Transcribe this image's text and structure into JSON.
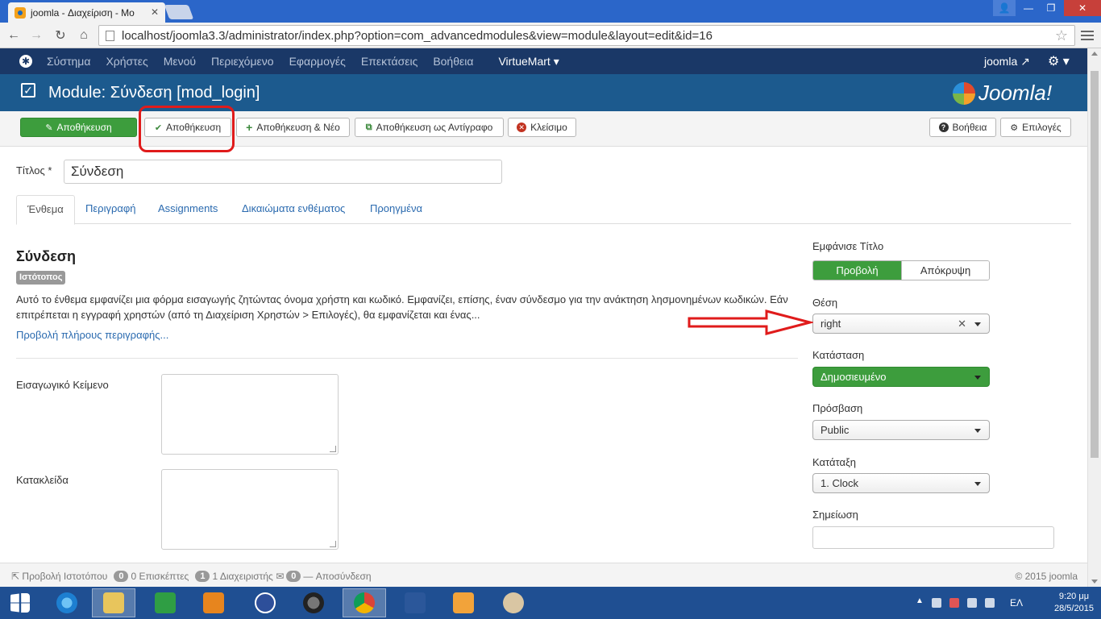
{
  "browser": {
    "tab_title": "joomla - Διαχείριση - Mo",
    "url": "localhost/joomla3.3/administrator/index.php?option=com_advancedmodules&view=module&layout=edit&id=16"
  },
  "nav": {
    "items": [
      "Σύστημα",
      "Χρήστες",
      "Μενού",
      "Περιεχόμενο",
      "Εφαρμογές",
      "Επεκτάσεις",
      "Βοήθεια"
    ],
    "virtuemart": "VirtueMart",
    "user": "joomla"
  },
  "header": {
    "title": "Module: Σύνδεση [mod_login]",
    "brand": "Joomla!"
  },
  "toolbar": {
    "apply": "Αποθήκευση",
    "save": "Αποθήκευση",
    "save_new": "Αποθήκευση & Νέο",
    "save_copy": "Αποθήκευση ως Αντίγραφο",
    "close": "Κλείσιμο",
    "help": "Βοήθεια",
    "options": "Επιλογές"
  },
  "form": {
    "title_label": "Τίτλος *",
    "title_value": "Σύνδεση",
    "tabs": [
      "Ένθεμα",
      "Περιγραφή",
      "Assignments",
      "Δικαιώματα ενθέματος",
      "Προηγμένα"
    ],
    "module_name": "Σύνδεση",
    "badge": "Ιστότοπος",
    "description": "Αυτό το ένθεμα εμφανίζει μια φόρμα εισαγωγής ζητώντας όνομα χρήστη και κωδικό. Εμφανίζει, επίσης, έναν σύνδεσμο για την ανάκτηση λησμονημένων κωδικών. Εάν επιτρέπεται η εγγραφή χρηστών (από τη Διαχείριση Χρηστών > Επιλογές), θα εμφανίζεται και ένας...",
    "more_link": "Προβολή πλήρους περιγραφής...",
    "intro_label": "Εισαγωγικό Κείμενο",
    "footer_label": "Κατακλείδα"
  },
  "sidebar": {
    "show_title_label": "Εμφάνισε Τίτλο",
    "show_on": "Προβολή",
    "show_off": "Απόκρυψη",
    "position_label": "Θέση",
    "position_value": "right",
    "status_label": "Κατάσταση",
    "status_value": "Δημοσιευμένο",
    "access_label": "Πρόσβαση",
    "access_value": "Public",
    "ordering_label": "Κατάταξη",
    "ordering_value": "1. Clock",
    "note_label": "Σημείωση"
  },
  "footer": {
    "view_site": "Προβολή Ιστοτόπου",
    "visitors_count": "0",
    "visitors": "0 Επισκέπτες",
    "admins_count": "1",
    "admins": "1 Διαχειριστής",
    "messages_count": "0",
    "logout": "Αποσύνδεση",
    "copyright": "© 2015 joomla"
  },
  "taskbar": {
    "lang": "ΕΛ",
    "time": "9:20 μμ",
    "date": "28/5/2015"
  },
  "colors": {
    "navbar": "#1a3867",
    "titlebar": "#1c5a8e",
    "success": "#3d9d3d",
    "link": "#2a6aaf",
    "highlight": "#e01b1b"
  }
}
